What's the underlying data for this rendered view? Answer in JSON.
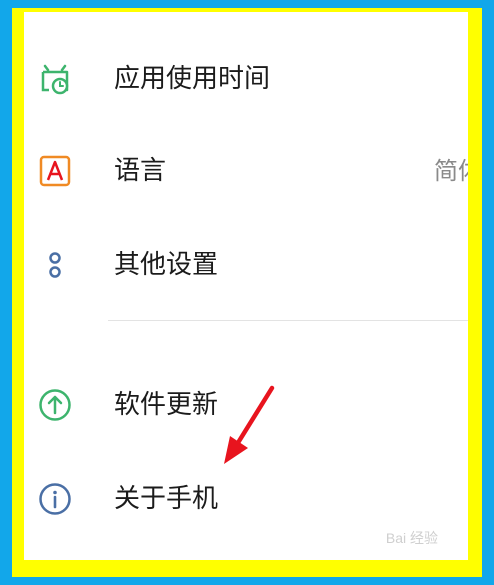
{
  "menu": {
    "items": [
      {
        "label": "应用使用时间",
        "icon": "app-usage-time-icon",
        "color": "#3db46d"
      },
      {
        "label": "语言",
        "value": "简体",
        "icon": "language-icon",
        "color": "#f08a24"
      },
      {
        "label": "其他设置",
        "icon": "other-settings-icon",
        "color": "#4a6fa5"
      },
      {
        "label": "软件更新",
        "icon": "software-update-icon",
        "color": "#3db46d"
      },
      {
        "label": "关于手机",
        "icon": "about-phone-icon",
        "color": "#4a6fa5"
      }
    ]
  },
  "watermark": "Bai 经验",
  "colors": {
    "frame_outer": "#12a7ea",
    "frame_inner": "#ffff00",
    "arrow": "#e8141e"
  }
}
